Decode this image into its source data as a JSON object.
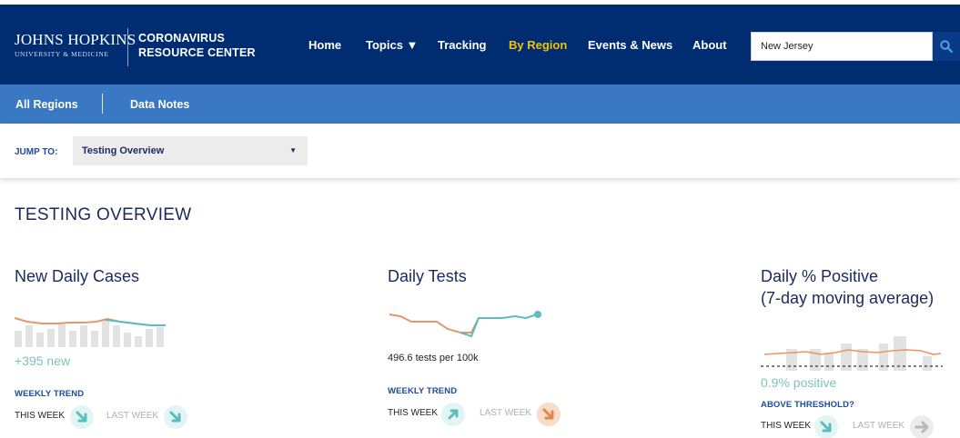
{
  "header": {
    "logo_line1": "JOHNS HOPKINS",
    "logo_line2": "UNIVERSITY & MEDICINE",
    "brand_line1": "CORONAVIRUS",
    "brand_line2": "RESOURCE CENTER",
    "nav": [
      {
        "label": "Home",
        "active": false
      },
      {
        "label": "Topics ▼",
        "active": false
      },
      {
        "label": "Tracking",
        "active": false
      },
      {
        "label": "By Region",
        "active": true
      },
      {
        "label": "Events & News",
        "active": false
      },
      {
        "label": "About",
        "active": false
      }
    ],
    "search_value": "New Jersey",
    "search_icon": "search-icon"
  },
  "subnav": {
    "items": [
      "All Regions",
      "Data Notes"
    ]
  },
  "jump": {
    "label": "JUMP TO:",
    "selected": "Testing Overview",
    "caret": "▼"
  },
  "section_title": "TESTING OVERVIEW",
  "cards": [
    {
      "title": "New Daily Cases",
      "stat": "+395 new",
      "trend_label": "WEEKLY TREND",
      "this_week": "THIS WEEK",
      "last_week": "LAST WEEK"
    },
    {
      "title": "Daily Tests",
      "stat": "496.6 tests per 100k",
      "trend_label": "WEEKLY TREND",
      "this_week": "THIS WEEK",
      "last_week": "LAST WEEK"
    },
    {
      "title_line1": "Daily % Positive",
      "title_line2": "(7-day moving average)",
      "stat": "0.9% positive",
      "trend_label": "ABOVE THRESHOLD?",
      "this_week": "THIS WEEK",
      "last_week": "LAST WEEK"
    }
  ],
  "colors": {
    "navy": "#002d72",
    "blue": "#3a78c3",
    "gold": "#f1c400",
    "teal": "#5bbdbd",
    "orange": "#e8956a",
    "bar_gray": "#e2e2e2"
  }
}
